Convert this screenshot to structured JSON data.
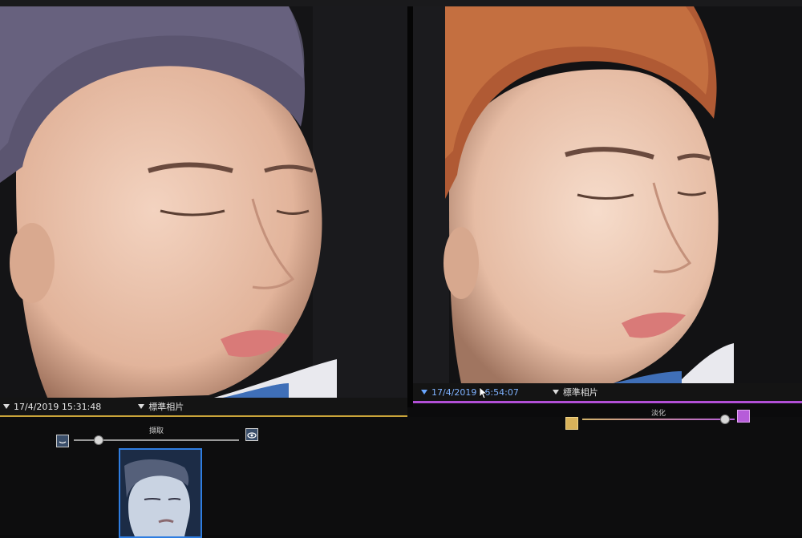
{
  "left_panel": {
    "date": "17/4/2019 15:31:48",
    "photo_type": "標準相片",
    "slider_label": "擷取"
  },
  "right_panel": {
    "date_prefix": "17/4/2019",
    "date_suffix": "6:54:07",
    "photo_type": "標準相片",
    "slider_label": "淡化"
  },
  "colors": {
    "left_accent": "#c9a43a",
    "right_accent": "#b24fd6",
    "date_blue": "#7fb2ff"
  },
  "icons": [
    "eye-open-icon",
    "eye-closed-icon",
    "swatch-icon",
    "cursor-icon"
  ]
}
